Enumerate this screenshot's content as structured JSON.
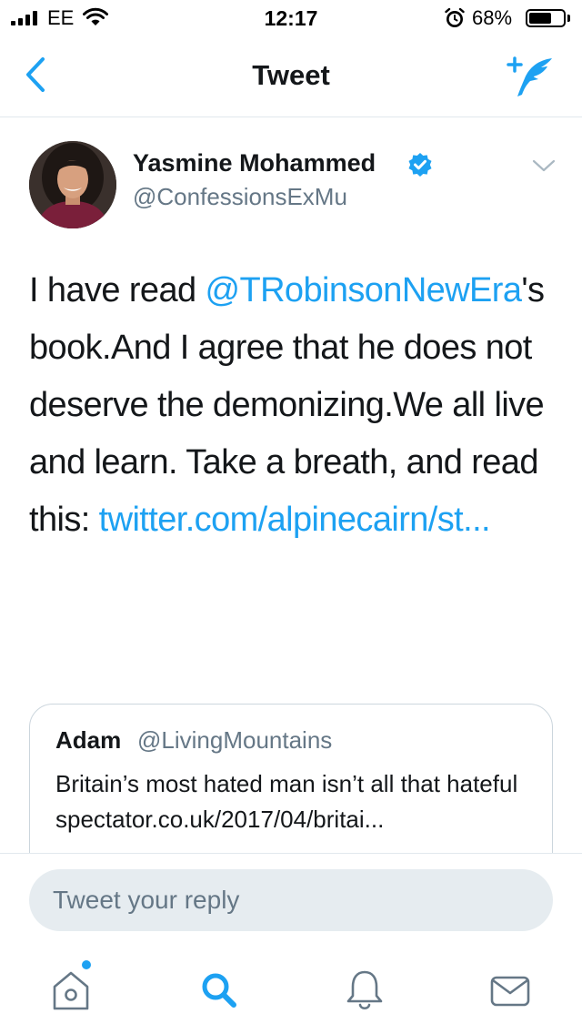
{
  "status_bar": {
    "carrier": "EE",
    "time": "12:17",
    "battery_percent": "68%",
    "battery_level": 0.68,
    "icons": [
      "signal-icon",
      "wifi-icon",
      "alarm-icon",
      "battery-icon"
    ]
  },
  "nav": {
    "title": "Tweet",
    "back_icon": "chevron-left-icon",
    "compose_icon": "compose-tweet-icon"
  },
  "tweet": {
    "author_name": "Yasmine Mohammed",
    "verified": true,
    "handle": "@ConfessionsExMu",
    "text_intro": "I have read ",
    "mention": "@TRobinsonNewEra",
    "text_middle": "'s book.And I agree that he does not deserve the demonizing.We all live and learn. Take a breath, and read this: ",
    "link": "twitter.com/alpinecairn/st..."
  },
  "quoted_tweet": {
    "author_name": "Adam",
    "handle": "@LivingMountains",
    "text": "Britain’s most hated man isn’t all that hateful spectator.co.uk/2017/04/britai..."
  },
  "reply": {
    "placeholder": "Tweet your reply"
  },
  "tab_bar": {
    "items": [
      "home-icon",
      "search-icon",
      "notifications-icon",
      "messages-icon"
    ],
    "accent_color": "#1da1f2"
  },
  "colors": {
    "accent": "#1da1f2",
    "text": "#14171a",
    "secondary_text": "#657786",
    "reply_background": "#e6ecf0"
  }
}
